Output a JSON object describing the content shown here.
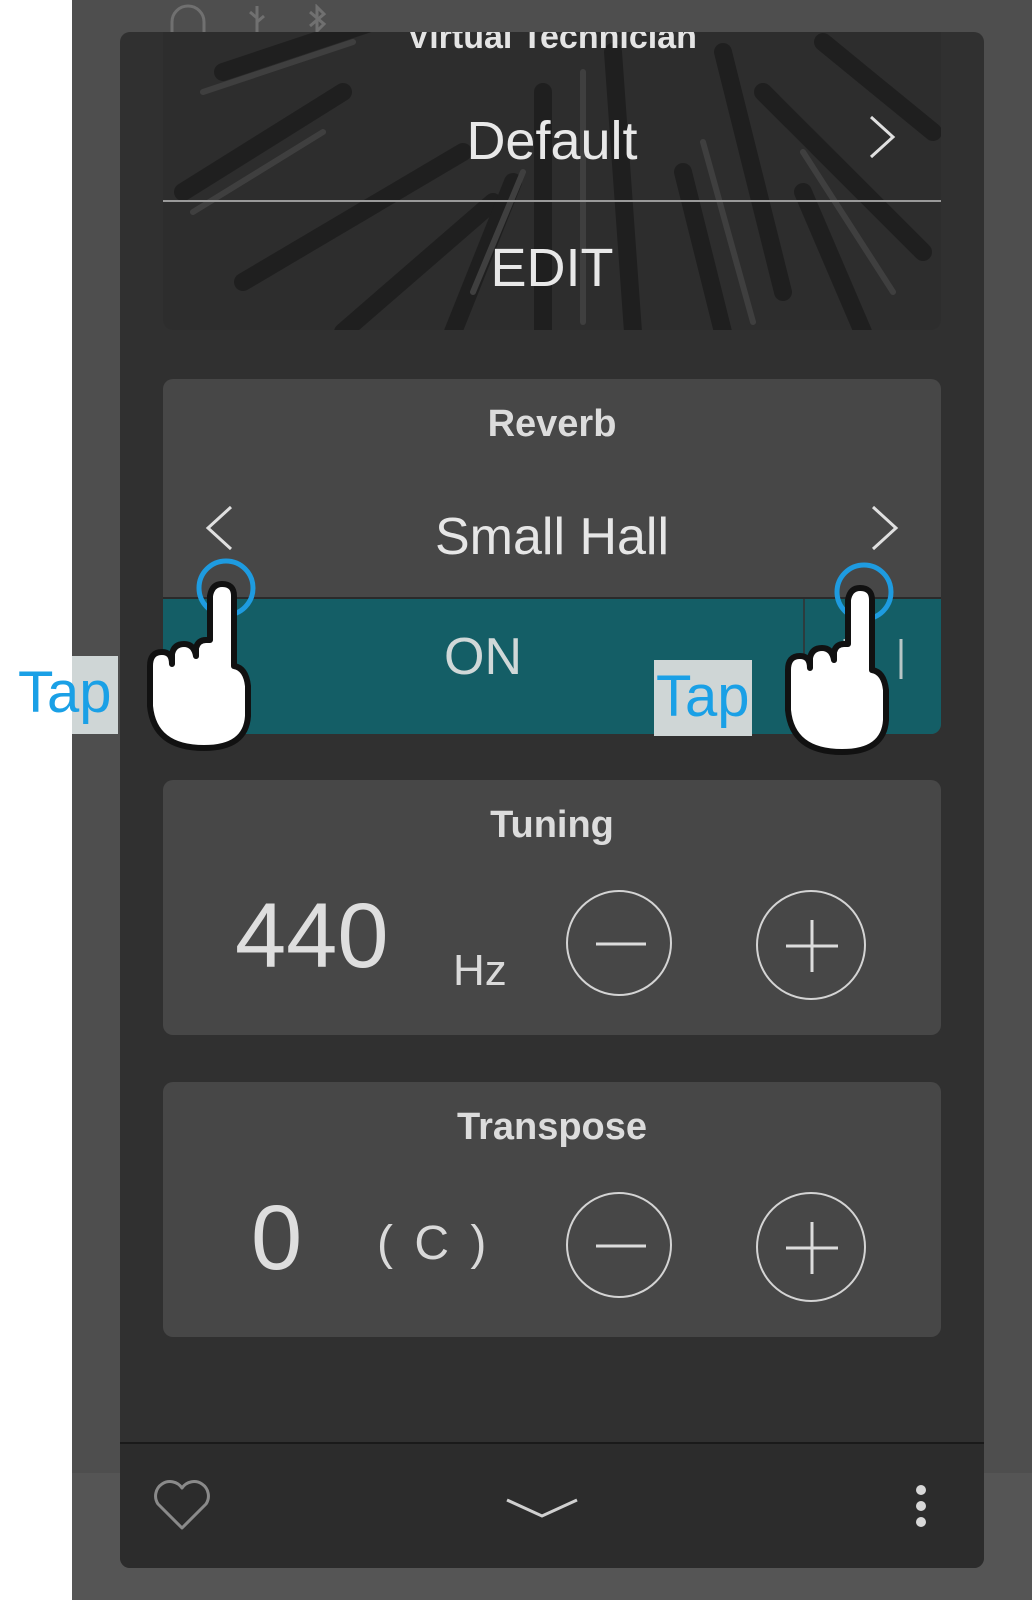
{
  "status_icons": [
    "headphones-icon",
    "usb-icon",
    "bluetooth-icon"
  ],
  "virtual_technician": {
    "title": "Virtual Technician",
    "value": "Default",
    "edit_label": "EDIT"
  },
  "reverb": {
    "title": "Reverb",
    "value": "Small Hall",
    "toggle_label": "ON"
  },
  "tuning": {
    "title": "Tuning",
    "value": "440",
    "unit": "Hz"
  },
  "transpose": {
    "title": "Transpose",
    "value": "0",
    "key": "( C )"
  },
  "annotations": {
    "tap_left": "Tap",
    "tap_right": "Tap"
  },
  "colors": {
    "accent_on": "#145e66",
    "tap_text": "#1aa0e6",
    "tap_ring": "#1e9be0"
  }
}
